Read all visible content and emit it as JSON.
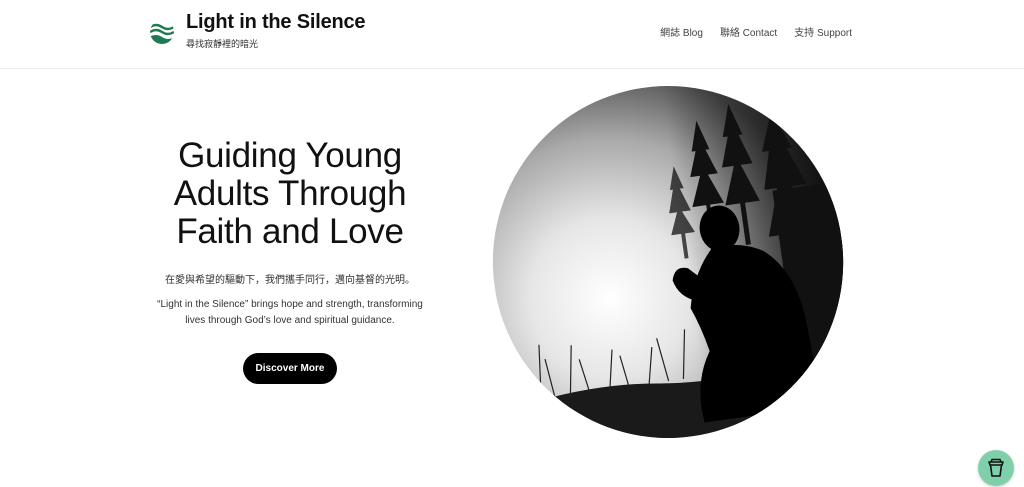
{
  "header": {
    "title": "Light in the Silence",
    "tagline": "尋找寂靜裡的暗光",
    "nav": [
      {
        "label": "網誌 Blog"
      },
      {
        "label": "聯絡 Contact"
      },
      {
        "label": "支持 Support"
      }
    ]
  },
  "hero": {
    "title_lines": [
      "Guiding Young",
      "Adults Through",
      "Faith and Love"
    ],
    "chinese": "在愛與希望的驅動下，我們攜手同行，邁向基督的光明。",
    "desc_lines": [
      "“Light in the Silence” brings hope and strength, transforming",
      "lives through God’s love and spiritual guidance."
    ],
    "cta_label": "Discover More",
    "image_icon": "praying-silhouette-icon"
  },
  "floating": {
    "icon": "coffee-cup-icon"
  },
  "colors": {
    "brand": "#1f7a53",
    "button": "#000000",
    "floating": "#7fd0aa"
  }
}
